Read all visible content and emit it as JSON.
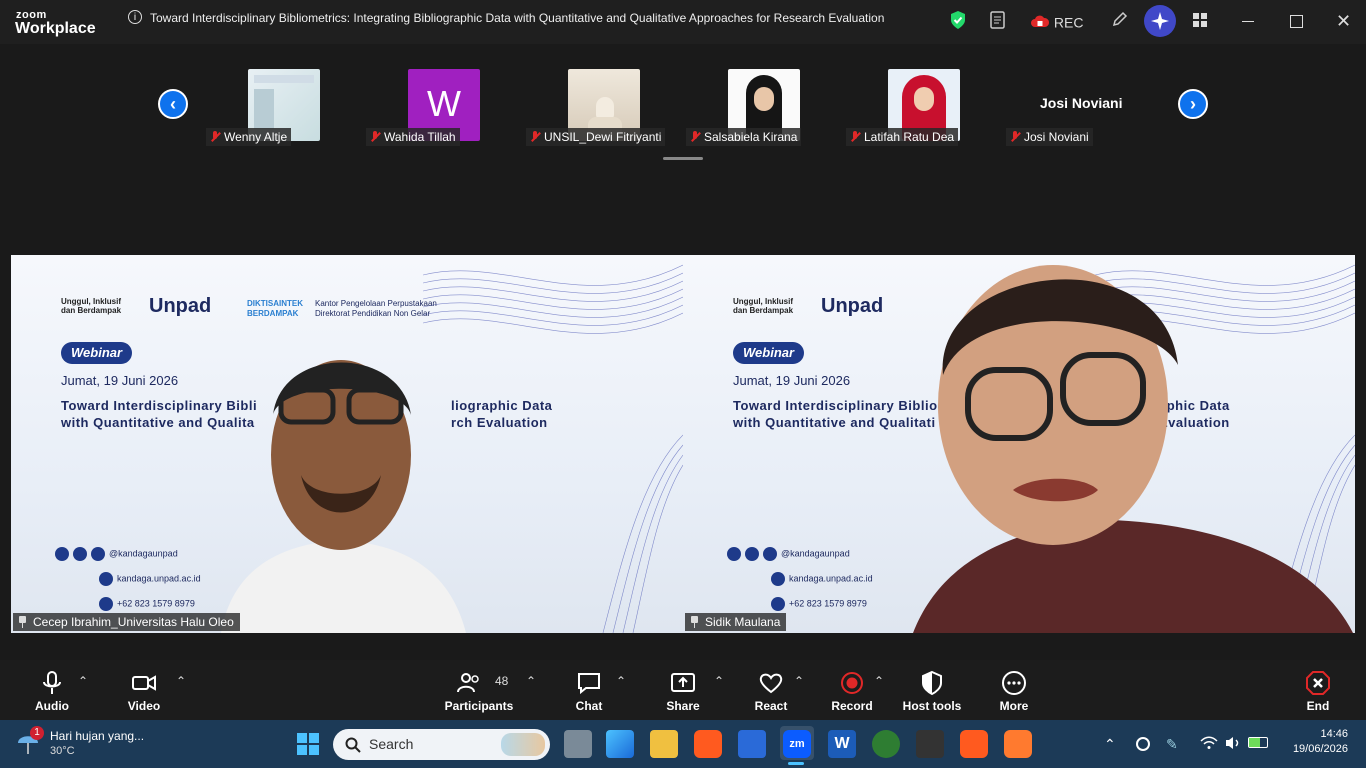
{
  "app": {
    "brand_top": "zoom",
    "brand_bottom": "Workplace"
  },
  "meeting": {
    "title": "Toward Interdisciplinary Bibliometrics: Integrating Bibliographic Data with Quantitative and Qualitative Approaches for Research Evaluation"
  },
  "titlebar": {
    "rec_label": "REC"
  },
  "gallery": {
    "participants": [
      {
        "name": "Wenny Altje",
        "tile": "image"
      },
      {
        "name": "Wahida Tillah",
        "tile": "initial",
        "initial": "W",
        "color": "#a020c0"
      },
      {
        "name": "UNSIL_Dewi Fitriyanti",
        "tile": "image"
      },
      {
        "name": "Salsabiela Kirana",
        "tile": "image"
      },
      {
        "name": "Latifah Ratu Dea",
        "tile": "image"
      },
      {
        "name": "Josi Noviani",
        "tile": "text",
        "display": "Josi Noviani"
      }
    ]
  },
  "slide": {
    "tagline_1": "Unggul, Inklusif",
    "tagline_2": "dan Berdampak",
    "unpad": "Unpad",
    "diktisaintek": "DIKTISAINTEK",
    "berdampak": "BERDAMPAK",
    "kantor_1": "Kantor Pengelolaan Perpustakaan",
    "kantor_2": "Direktorat Pendidikan Non Gelar",
    "webinar": "Webinar",
    "date": "Jumat, 19 Juni 2026",
    "title_left_1": "Toward Interdisciplinary Bibli",
    "title_left_2": "with Quantitative and Qualita",
    "title_right_a1": "liographic Data",
    "title_right_a2": "rch Evaluation",
    "title_left_b1": "Toward Interdisciplinary Bibliog",
    "title_left_b2": "with Quantitative and Qualitati",
    "title_right_b1": "aphic Data",
    "title_right_b2": "Evaluation",
    "social": "@kandagaunpad",
    "website": "kandaga.unpad.ac.id",
    "phone": "+62 823 1579 8979"
  },
  "videos": [
    {
      "name": "Cecep Ibrahim_Universitas Halu Oleo",
      "active": false
    },
    {
      "name": "Sidik Maulana",
      "active": true
    }
  ],
  "toolbar": {
    "audio": "Audio",
    "video": "Video",
    "participants": "Participants",
    "participants_count": "48",
    "chat": "Chat",
    "share": "Share",
    "react": "React",
    "record": "Record",
    "host_tools": "Host tools",
    "more": "More",
    "end": "End"
  },
  "taskbar": {
    "weather_text": "Hari hujan yang...",
    "temperature": "30°C",
    "weather_badge": "1",
    "search_label": "Search",
    "time": "14:46",
    "date": "19/06/2026"
  },
  "colors": {
    "accent": "#0e72ed",
    "active_border": "#23d96b",
    "end_red": "#e02828"
  }
}
